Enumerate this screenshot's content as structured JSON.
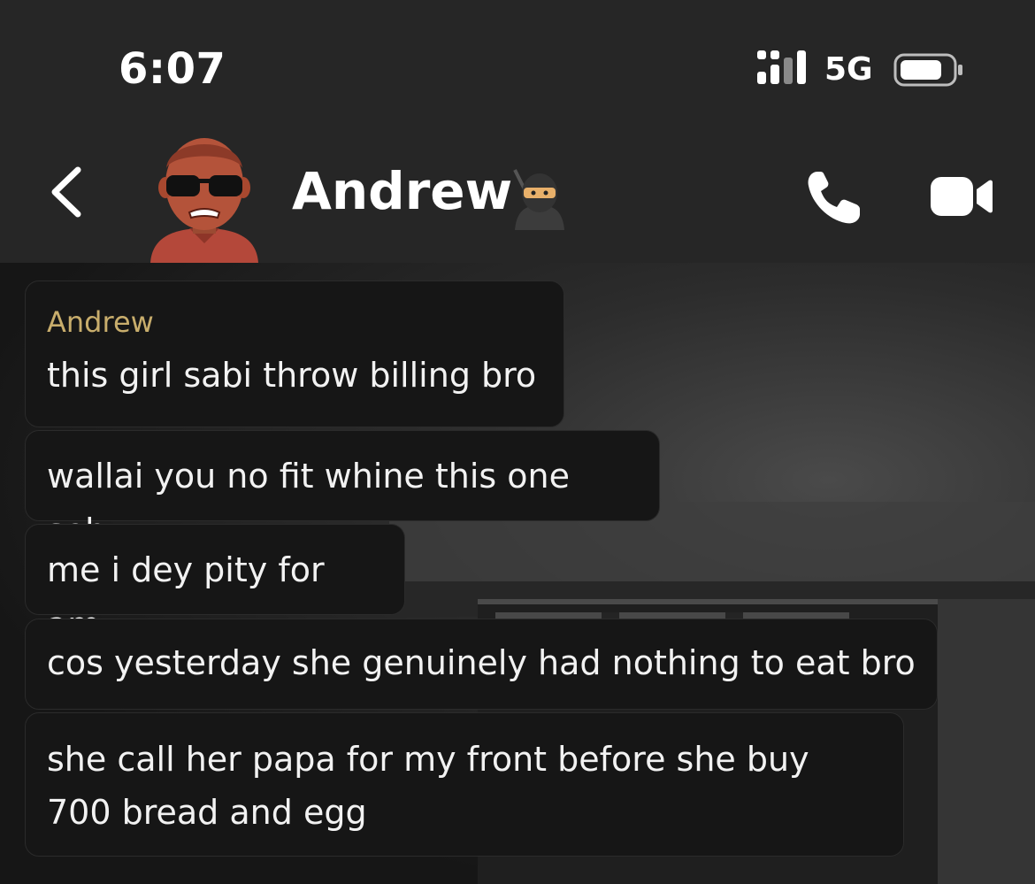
{
  "status_bar": {
    "time": "6:07",
    "network": "5G",
    "signal_icon": "signal-bars-icon",
    "battery_icon": "battery-icon"
  },
  "header": {
    "back_icon": "chevron-left-icon",
    "contact_name": "Andrew",
    "contact_emoji": "ninja-emoji-icon",
    "call_icon": "phone-icon",
    "video_icon": "video-camera-icon"
  },
  "messages": [
    {
      "sender": "Andrew",
      "text": "this girl sabi throw billing bro"
    },
    {
      "text": "wallai you no fit whine this one seh"
    },
    {
      "text": "me i dey pity for am"
    },
    {
      "text": "cos yesterday she genuinely had nothing to eat bro"
    },
    {
      "text": "she call her papa for my front before she buy 700 bread and egg"
    }
  ],
  "colors": {
    "bar_background": "#262626",
    "bubble_background": "#161616",
    "sender_name": "#c8ad6c"
  }
}
